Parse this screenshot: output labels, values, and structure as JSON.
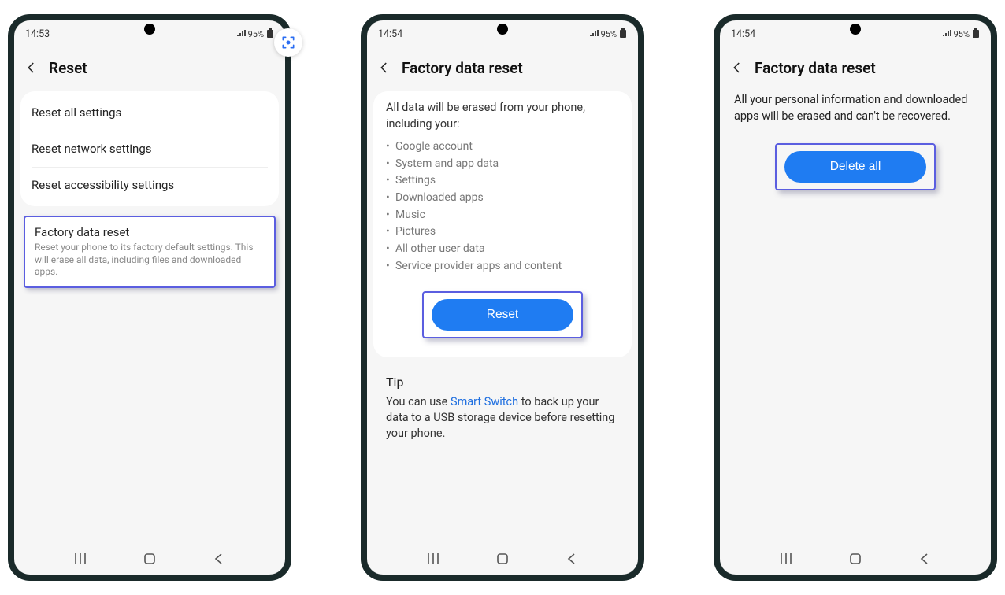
{
  "status": {
    "time1": "14:53",
    "time2": "14:54",
    "time3": "14:54",
    "battery": "95%"
  },
  "screen1": {
    "title": "Reset",
    "items": [
      "Reset all settings",
      "Reset network settings",
      "Reset accessibility settings"
    ],
    "factory": {
      "title": "Factory data reset",
      "sub": "Reset your phone to its factory default settings. This will erase all data, including files and downloaded apps."
    }
  },
  "screen2": {
    "title": "Factory data reset",
    "lead": "All data will be erased from your phone, including your:",
    "bullets": [
      "Google account",
      "System and app data",
      "Settings",
      "Downloaded apps",
      "Music",
      "Pictures",
      "All other user data",
      "Service provider apps and content"
    ],
    "button": "Reset",
    "tip_heading": "Tip",
    "tip_pre": "You can use ",
    "tip_link": "Smart Switch",
    "tip_post": " to back up your data to a USB storage device before resetting your phone."
  },
  "screen3": {
    "title": "Factory data reset",
    "lead": "All your personal information and downloaded apps will be erased and can't be recovered.",
    "button": "Delete all"
  }
}
